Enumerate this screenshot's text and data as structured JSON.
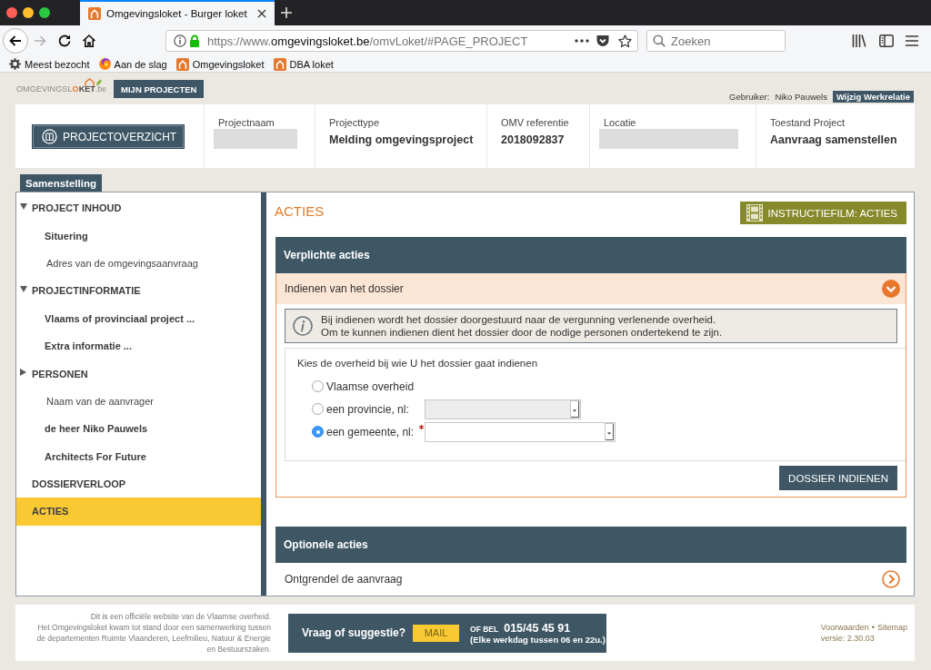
{
  "browser": {
    "tab_title": "Omgevingsloket - Burger loket",
    "forward_disabled": true,
    "url": {
      "before_domain": "https://www.",
      "domain": "omgevingsloket.be",
      "after_domain": "/omvLoket/#PAGE_PROJECT"
    },
    "search": {
      "placeholder": "Zoeken"
    },
    "bookmarks": [
      {
        "label": "Meest bezocht",
        "kind": "smart"
      },
      {
        "label": "Aan de slag",
        "kind": "start"
      },
      {
        "label": "Omgevingsloket",
        "kind": "site"
      },
      {
        "label": "DBA loket",
        "kind": "site"
      }
    ]
  },
  "site_header": {
    "logo": [
      "OMGEVINGSL",
      "O",
      "KET",
      ".be"
    ],
    "nav_button": "MIJN PROJECTEN",
    "user_label": "Gebruiker:",
    "user_name": "Niko Pauwels",
    "relation_button": "Wijzig Werkrelatie"
  },
  "project_header": {
    "overview_button": "PROJECTOVERZICHT",
    "fields": [
      {
        "label": "Projectnaam",
        "kind": "redacted"
      },
      {
        "label": "Projecttype",
        "kind": "text",
        "value": "Melding omgevingsproject"
      },
      {
        "label": "OMV referentie",
        "kind": "text",
        "value": "2018092837"
      },
      {
        "label": "Locatie",
        "kind": "redacted"
      },
      {
        "label": "Toestand Project",
        "kind": "text",
        "value": "Aanvraag samenstellen"
      }
    ]
  },
  "sidebar": {
    "tab": "Samenstelling",
    "items": [
      {
        "label": "PROJECT INHOUD",
        "kind": "group",
        "expanded": true,
        "selected": false,
        "children": [
          {
            "label": "Situering",
            "kind": "page",
            "selected": false
          },
          {
            "label": "Adres van de omgevingsaanvraag",
            "kind": "heading",
            "selected": false
          }
        ]
      },
      {
        "label": "PROJECTINFORMATIE",
        "kind": "group",
        "expanded": true,
        "selected": false,
        "children": [
          {
            "label": "Vlaams of provinciaal project ...",
            "kind": "page",
            "selected": false
          },
          {
            "label": "Extra informatie ...",
            "kind": "page",
            "selected": false
          }
        ]
      },
      {
        "label": "PERSONEN",
        "kind": "group",
        "expanded": false,
        "selected": false,
        "children": [
          {
            "label": "Naam van de aanvrager",
            "kind": "heading",
            "selected": false
          },
          {
            "label": "de heer Niko Pauwels",
            "kind": "page",
            "selected": false
          },
          {
            "label": "Architects For Future",
            "kind": "page",
            "selected": false
          }
        ]
      },
      {
        "label": "DOSSIERVERLOOP",
        "kind": "page",
        "selected": false
      },
      {
        "label": "ACTIES",
        "kind": "page",
        "selected": true
      }
    ]
  },
  "content": {
    "title": "ACTIES",
    "video_button": "INSTRUCTIEFILM: ACTIES",
    "sections": [
      {
        "title": "Verplichte acties",
        "items": [
          {
            "title": "Indienen van het dossier",
            "expanded": true,
            "info": [
              "Bij indienen wordt het dossier doorgestuurd naar de vergunning verlenende overheid.",
              "Om te kunnen indienen dient het dossier door de nodige personen ondertekend te zijn."
            ],
            "question": "Kies de overheid bij wie U het dossier gaat indienen",
            "options": [
              {
                "label": "Vlaamse overheid",
                "kind": "plain",
                "selected": false
              },
              {
                "label": "een provincie, nl:",
                "kind": "select",
                "selected": false,
                "disabled": true,
                "required": false
              },
              {
                "label": "een gemeente, nl:",
                "kind": "select",
                "selected": true,
                "disabled": false,
                "required": true
              }
            ],
            "submit_button": "DOSSIER INDIENEN"
          }
        ]
      },
      {
        "title": "Optionele acties",
        "items": [
          {
            "title": "Ontgrendel de aanvraag",
            "expanded": false
          }
        ]
      }
    ]
  },
  "footer": {
    "notice": "Dit is een officiële website van de Vlaamse overheid.",
    "credits": "Het Omgevingsloket kwam tot stand door een samenwerking tussen de departementen Ruimte Vlaanderen, Leefmilieu, Natuur & Energie en Bestuurszaken.",
    "contact": {
      "question": "Vraag of suggestie?",
      "mail_button": "MAIL",
      "phone_label": "OF BEL",
      "phone": "015/45 45 91",
      "hours": "(Elke werkdag tussen 06 en 22u.)"
    },
    "links": [
      "Voorwaarden",
      "Sitemap"
    ],
    "separator": "•",
    "version": "versie: 2.30.03"
  }
}
